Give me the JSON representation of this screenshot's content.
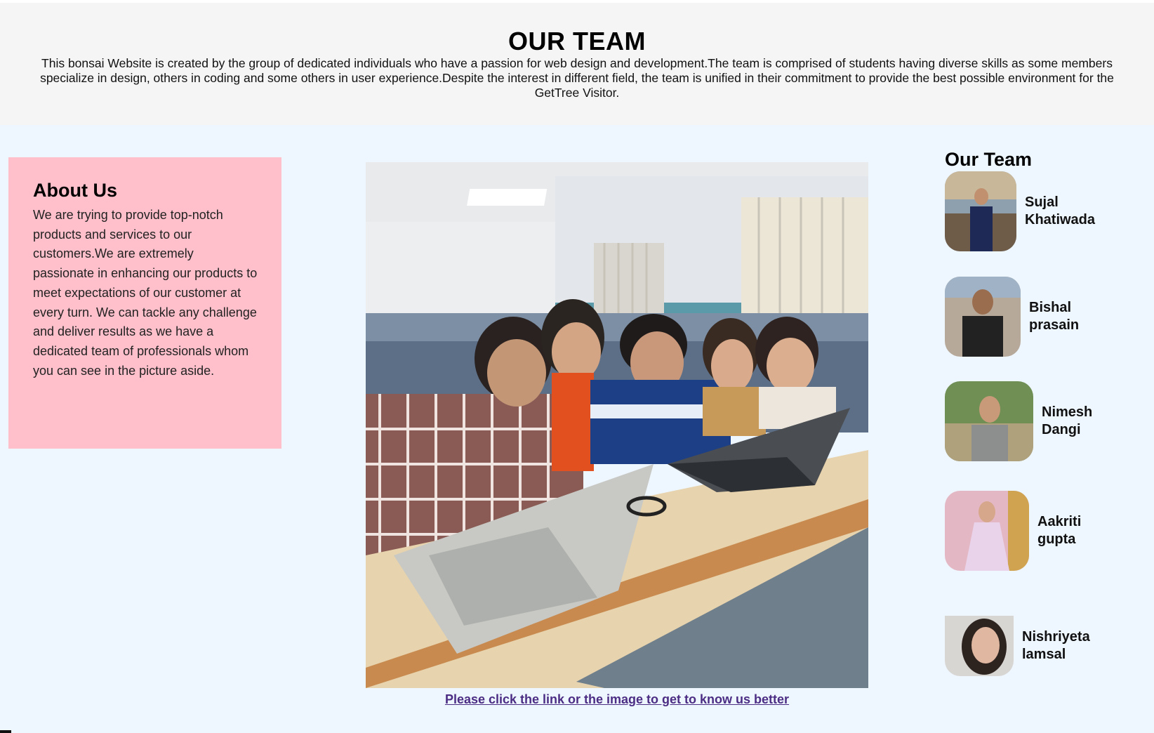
{
  "header": {
    "title": "OUR TEAM",
    "description": "This bonsai Website is created by the group of dedicated individuals who have a passion for web design and development.The team is comprised of students having diverse skills as some members specialize in design, others in coding and some others in user experience.Despite the interest in different field, the team is unified in their commitment to provide the best possible environment for the GetTree Visitor."
  },
  "about": {
    "title": "About Us",
    "text": "We are trying to provide top-notch products and services to our customers.We are extremely passionate in enhancing our products to meet expectations of our customer at every turn. We can tackle any challenge and deliver results as we have a dedicated team of professionals whom you can see in the picture aside."
  },
  "main": {
    "link_text": "Please click the link or the image to get to know us better"
  },
  "sidebar": {
    "title": "Our Team",
    "members": [
      {
        "first": "Sujal",
        "last": "Khatiwada"
      },
      {
        "first": "Bishal",
        "last": "prasain"
      },
      {
        "first": "Nimesh",
        "last": "Dangi"
      },
      {
        "first": "Aakriti",
        "last": "gupta"
      },
      {
        "first": "Nishriyeta",
        "last": "lamsal"
      }
    ]
  },
  "colors": {
    "header_bg": "#f5f5f5",
    "main_bg": "#eef6ff",
    "about_bg": "#ffc0cb",
    "link": "#4b2d84"
  }
}
